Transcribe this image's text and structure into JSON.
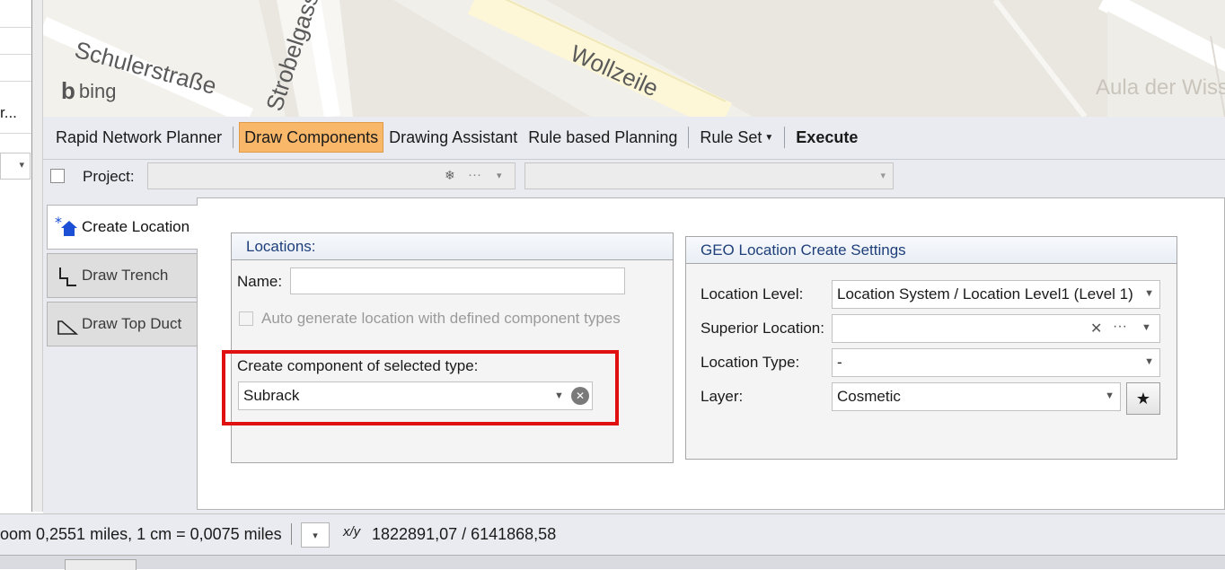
{
  "map": {
    "streets": [
      "Schulerstraße",
      "Strobelgasse",
      "Wollzeile"
    ],
    "landmark": "Aula der Wissenschaften",
    "attribution": "bing",
    "splitter_grip": ".....",
    "left_panel_text": "r...",
    "left_panel_arrow": "▾"
  },
  "toolbar": {
    "items": [
      "Rapid Network Planner",
      "Draw Components",
      "Drawing Assistant",
      "Rule based Planning",
      "Rule Set",
      "Execute"
    ],
    "active": "Draw Components",
    "accent_color": "#f9b76a"
  },
  "project_bar": {
    "label": "Project:",
    "snowflake": "❄",
    "ellipsis": "···",
    "arrow": "▾"
  },
  "tabs": {
    "create_location": "Create Location",
    "draw_trench": "Draw Trench",
    "draw_top_duct": "Draw Top Duct"
  },
  "locations": {
    "header": "Locations:",
    "name_label": "Name:",
    "name_value": "",
    "auto_generate_label": "Auto generate location with defined component types",
    "create_component_label": "Create component of selected type:",
    "component_type": "Subrack"
  },
  "geo_settings": {
    "header": "GEO Location Create Settings",
    "location_level_label": "Location Level:",
    "location_level_value": "Location System / Location Level1 (Level 1)",
    "superior_location_label": "Superior Location:",
    "superior_location_value": "",
    "location_type_label": "Location Type:",
    "location_type_value": "-",
    "layer_label": "Layer:",
    "layer_value": "Cosmetic",
    "clear_icon": "✕",
    "ellipsis": "···",
    "star": "★"
  },
  "status": {
    "scale_text": "oom 0,2551 miles, 1 cm = 0,0075 miles",
    "xy_label": "x/y",
    "coords": "1822891,07 / 6141868,58",
    "dd_arrow": "▾"
  }
}
